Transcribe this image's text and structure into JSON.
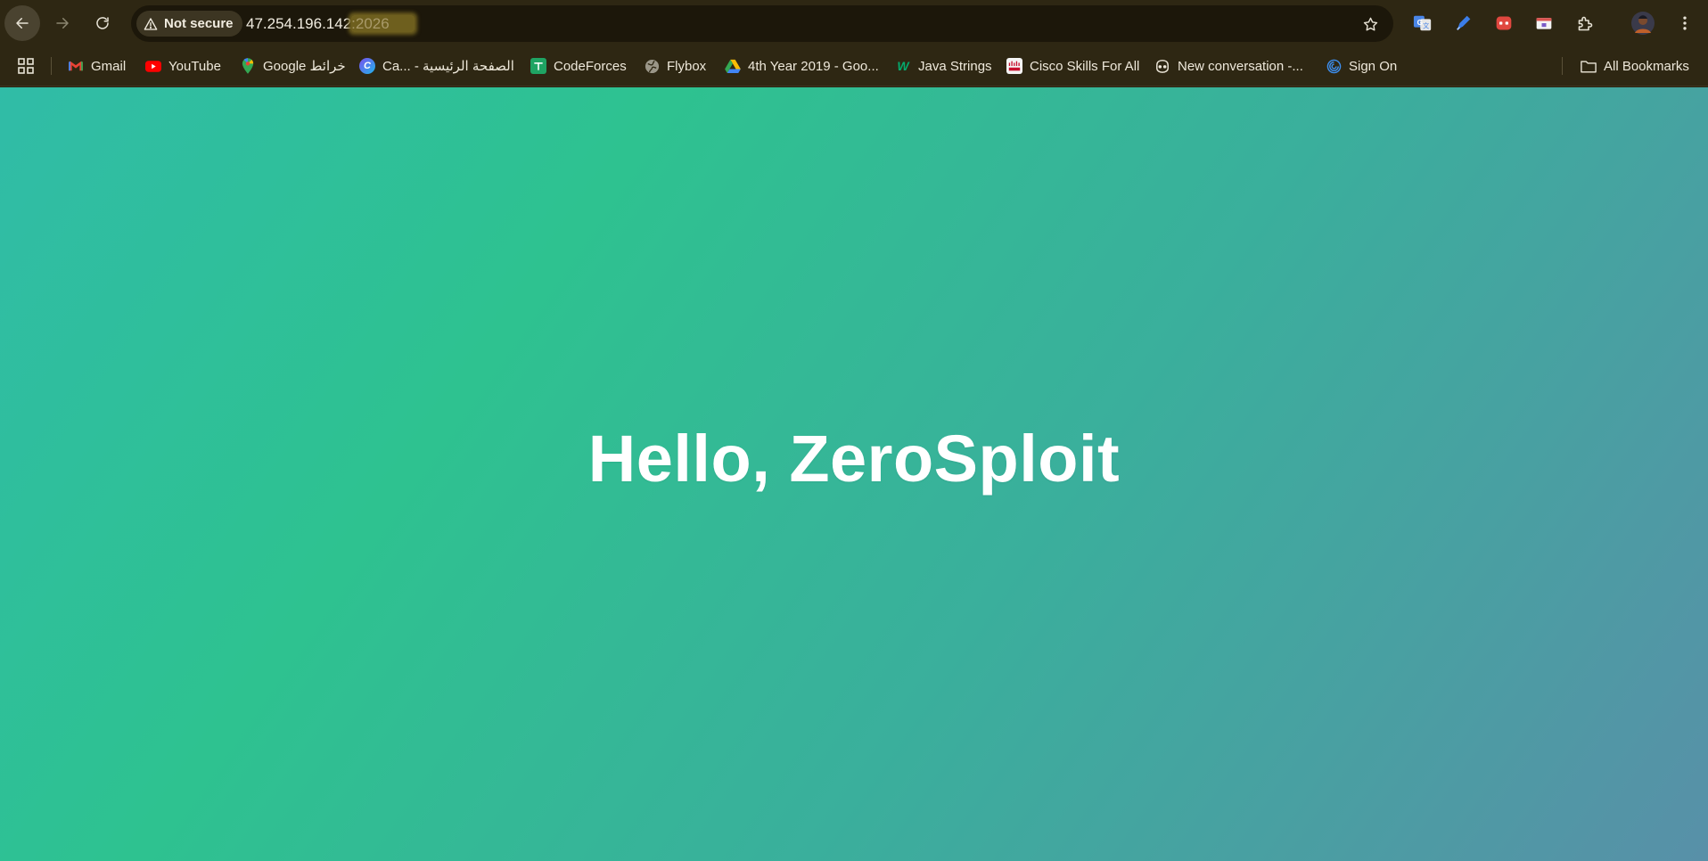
{
  "browser": {
    "security_label": "Not secure",
    "url_host": "47.254.196.142",
    "url_port": ":2026",
    "bookmark_star": "bookmark-star-icon",
    "colors": {
      "toolbar": "#2e2713",
      "omnibox": "#1c170a",
      "accent_text": "#f1ece0"
    }
  },
  "extensions": [
    {
      "name": "google-translate-icon"
    },
    {
      "name": "pen-extension-icon"
    },
    {
      "name": "red-extension-icon"
    },
    {
      "name": "card-extension-icon"
    },
    {
      "name": "extensions-puzzle-icon"
    },
    {
      "name": "profile-avatar"
    },
    {
      "name": "more-menu-icon"
    }
  ],
  "bookmarks": {
    "items": [
      {
        "label": "Gmail",
        "icon": "gmail-icon"
      },
      {
        "label": "YouTube",
        "icon": "youtube-icon"
      },
      {
        "label": "Google خرائط",
        "icon": "maps-icon"
      },
      {
        "label": "Ca... - الصفحة الرئيسية",
        "icon": "canva-icon"
      },
      {
        "label": "CodeForces",
        "icon": "codeforces-icon"
      },
      {
        "label": "Flybox",
        "icon": "globe-icon"
      },
      {
        "label": "4th Year 2019 - Goo...",
        "icon": "google-drive-icon"
      },
      {
        "label": "Java Strings",
        "icon": "w3-icon"
      },
      {
        "label": "Cisco Skills For All",
        "icon": "cisco-icon"
      },
      {
        "label": "New conversation -...",
        "icon": "copilot-icon"
      },
      {
        "label": "Sign On",
        "icon": "signon-icon"
      }
    ],
    "all_bookmarks_label": "All Bookmarks"
  },
  "page": {
    "heading": "Hello, ZeroSploit",
    "gradient_colors": [
      "#30bca7",
      "#2ec290",
      "#3aaf9c",
      "#5890a8"
    ]
  }
}
